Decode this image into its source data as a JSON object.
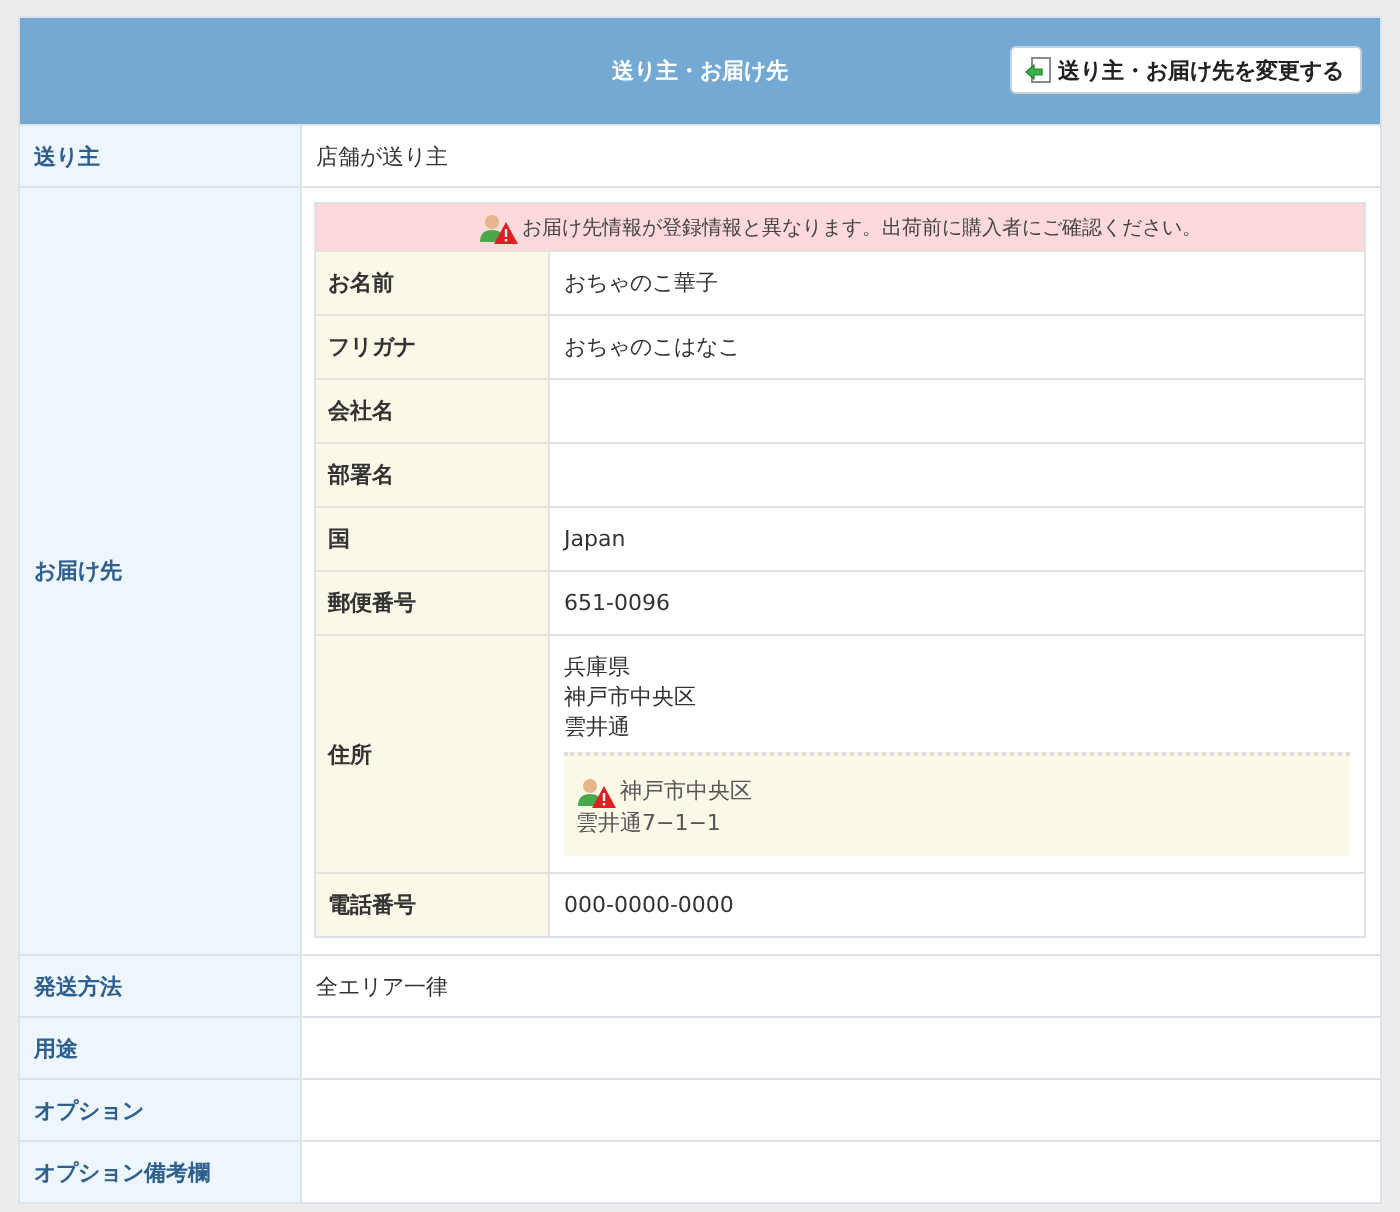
{
  "header": {
    "title": "送り主・お届け先",
    "button": "送り主・お届け先を変更する"
  },
  "rows": [
    {
      "kind": "text",
      "label": "送り主",
      "value": "店舗が送り主"
    },
    {
      "kind": "recipient",
      "label": "お届け先",
      "warning": "お届け先情報が登録情報と異なります。出荷前に購入者にご確認ください。",
      "fields": [
        {
          "label": "お名前",
          "lines": [
            "おちゃのこ華子"
          ]
        },
        {
          "label": "フリガナ",
          "lines": [
            "おちゃのこはなこ"
          ]
        },
        {
          "label": "会社名"
        },
        {
          "label": "部署名"
        },
        {
          "label": "国",
          "lines": [
            "Japan"
          ]
        },
        {
          "label": "郵便番号",
          "lines": [
            "651-0096"
          ]
        },
        {
          "label": "住所",
          "lines": [
            "兵庫県",
            "神戸市中央区",
            "雲井通"
          ],
          "registered": [
            "神戸市中央区",
            "雲井通7−1−1"
          ]
        },
        {
          "label": "電話番号",
          "lines": [
            "000-0000-0000"
          ]
        }
      ]
    },
    {
      "kind": "text",
      "label": "発送方法",
      "value": "全エリア一律"
    },
    {
      "kind": "text",
      "label": "用途"
    },
    {
      "kind": "text",
      "label": "オプション"
    },
    {
      "kind": "text",
      "label": "オプション備考欄"
    }
  ]
}
